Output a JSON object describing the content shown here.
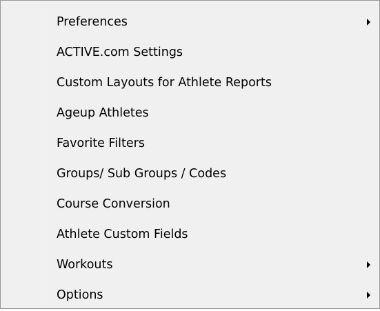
{
  "menu": {
    "items": [
      {
        "label": "Preferences",
        "submenu": true,
        "icon": "chevron-right-icon"
      },
      {
        "label": "ACTIVE.com Settings",
        "submenu": false
      },
      {
        "label": "Custom Layouts for Athlete Reports",
        "submenu": false
      },
      {
        "label": "Ageup Athletes",
        "submenu": false
      },
      {
        "label": "Favorite Filters",
        "submenu": false
      },
      {
        "label": "Groups/ Sub Groups / Codes",
        "submenu": false
      },
      {
        "label": "Course Conversion",
        "submenu": false
      },
      {
        "label": "Athlete Custom Fields",
        "submenu": false
      },
      {
        "label": "Workouts",
        "submenu": true,
        "icon": "chevron-right-icon"
      },
      {
        "label": "Options",
        "submenu": true,
        "icon": "chevron-right-icon"
      }
    ]
  },
  "colors": {
    "menu_background": "#f0f0f0",
    "border": "#979797",
    "text": "#000000"
  }
}
